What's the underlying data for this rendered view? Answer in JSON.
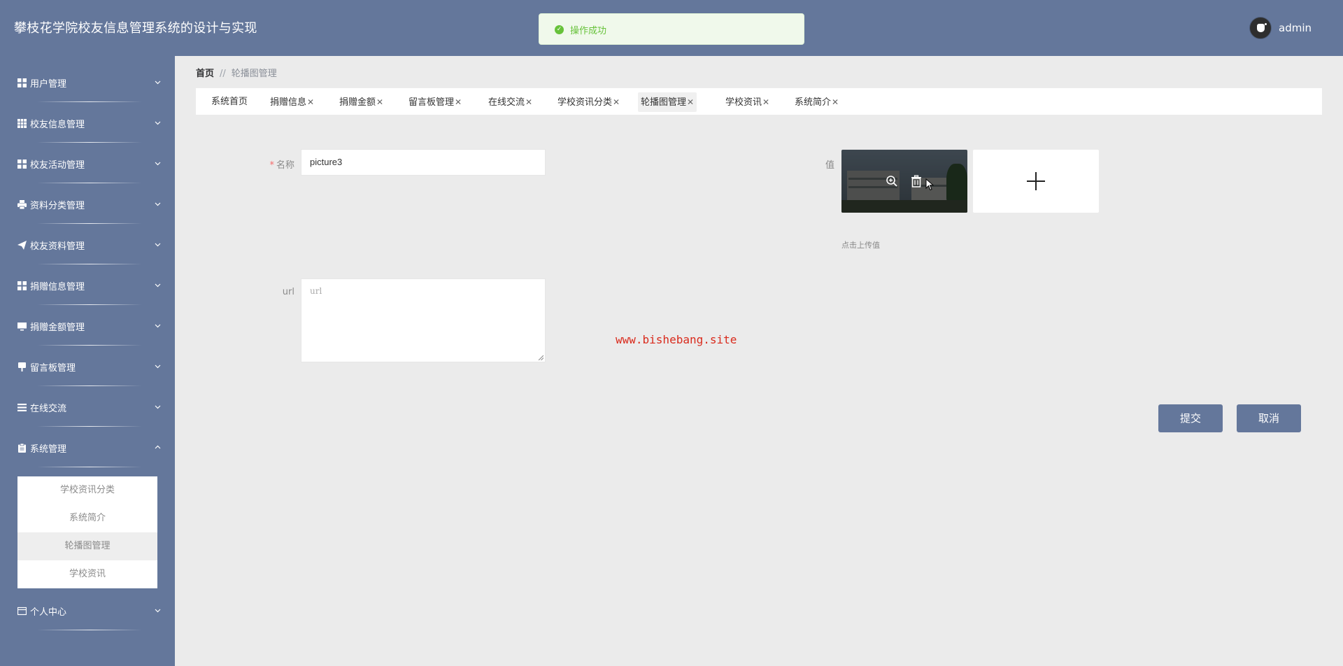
{
  "header": {
    "title": "攀枝花学院校友信息管理系统的设计与实现",
    "toast": "操作成功",
    "username": "admin"
  },
  "sidebar": {
    "items": [
      {
        "label": "用户管理",
        "icon": "grid-icon"
      },
      {
        "label": "校友信息管理",
        "icon": "table-icon"
      },
      {
        "label": "校友活动管理",
        "icon": "grid-icon"
      },
      {
        "label": "资料分类管理",
        "icon": "printer-icon"
      },
      {
        "label": "校友资料管理",
        "icon": "send-icon"
      },
      {
        "label": "捐赠信息管理",
        "icon": "grid-icon"
      },
      {
        "label": "捐赠金额管理",
        "icon": "monitor-icon"
      },
      {
        "label": "留言板管理",
        "icon": "pin-icon"
      },
      {
        "label": "在线交流",
        "icon": "list-icon"
      },
      {
        "label": "系统管理",
        "icon": "clipboard-icon",
        "expanded": true
      },
      {
        "label": "个人中心",
        "icon": "card-icon"
      }
    ],
    "submenu": [
      {
        "label": "学校资讯分类"
      },
      {
        "label": "系统简介"
      },
      {
        "label": "轮播图管理",
        "active": true
      },
      {
        "label": "学校资讯"
      }
    ]
  },
  "breadcrumb": {
    "home": "首页",
    "separator": "//",
    "current": "轮播图管理"
  },
  "tabs": [
    {
      "label": "系统首页",
      "closable": false
    },
    {
      "label": "捐赠信息",
      "closable": true
    },
    {
      "label": "捐赠金额",
      "closable": true
    },
    {
      "label": "留言板管理",
      "closable": true
    },
    {
      "label": "在线交流",
      "closable": true
    },
    {
      "label": "学校资讯分类",
      "closable": true
    },
    {
      "label": "轮播图管理",
      "closable": true,
      "active": true
    },
    {
      "label": "学校资讯",
      "closable": true
    },
    {
      "label": "系统简介",
      "closable": true
    }
  ],
  "tab_close_glyph": "✕",
  "form": {
    "name_label": "名称",
    "name_required": "*",
    "name_value": "picture3",
    "value_label": "值",
    "upload_hint": "点击上传值",
    "url_label": "url",
    "url_placeholder": "url"
  },
  "watermark": "www.bishebang.site",
  "buttons": {
    "submit": "提交",
    "cancel": "取消"
  },
  "colors": {
    "primary": "#64779b",
    "success": "#67c23a",
    "watermark": "#d92a1c"
  }
}
